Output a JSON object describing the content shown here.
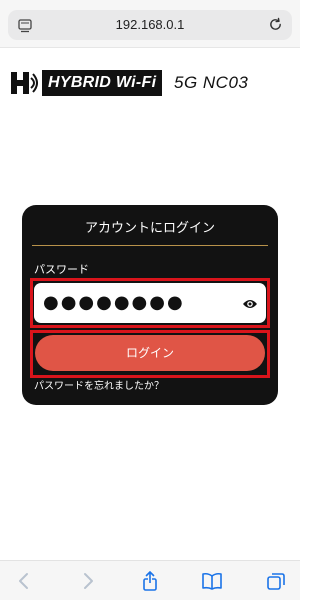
{
  "browser": {
    "url": "192.168.0.1",
    "menu_icon": "page-menu-icon",
    "reload_icon": "reload-icon",
    "toolbar": {
      "icons": [
        "back-icon",
        "forward-icon",
        "share-icon",
        "bookmarks-icon",
        "tabs-icon"
      ],
      "colors": {
        "active": "#1a73e8",
        "inactive": "#b9c3cf"
      }
    }
  },
  "brand": {
    "logo_icon": "hybrid-logo-icon",
    "product_name": "HYBRID Wi-Fi",
    "model": "5G NC03"
  },
  "login": {
    "title": "アカウントにログイン",
    "password_label": "パスワード",
    "password_value": "●●●●●●●●",
    "eye_icon": "eye-icon",
    "button_label": "ログイン",
    "forgot_link": "パスワードを忘れましたか？",
    "colors": {
      "card_bg": "#121212",
      "divider": "#b8924a",
      "button_bg": "#e05546",
      "highlight": "#d9141b"
    }
  }
}
